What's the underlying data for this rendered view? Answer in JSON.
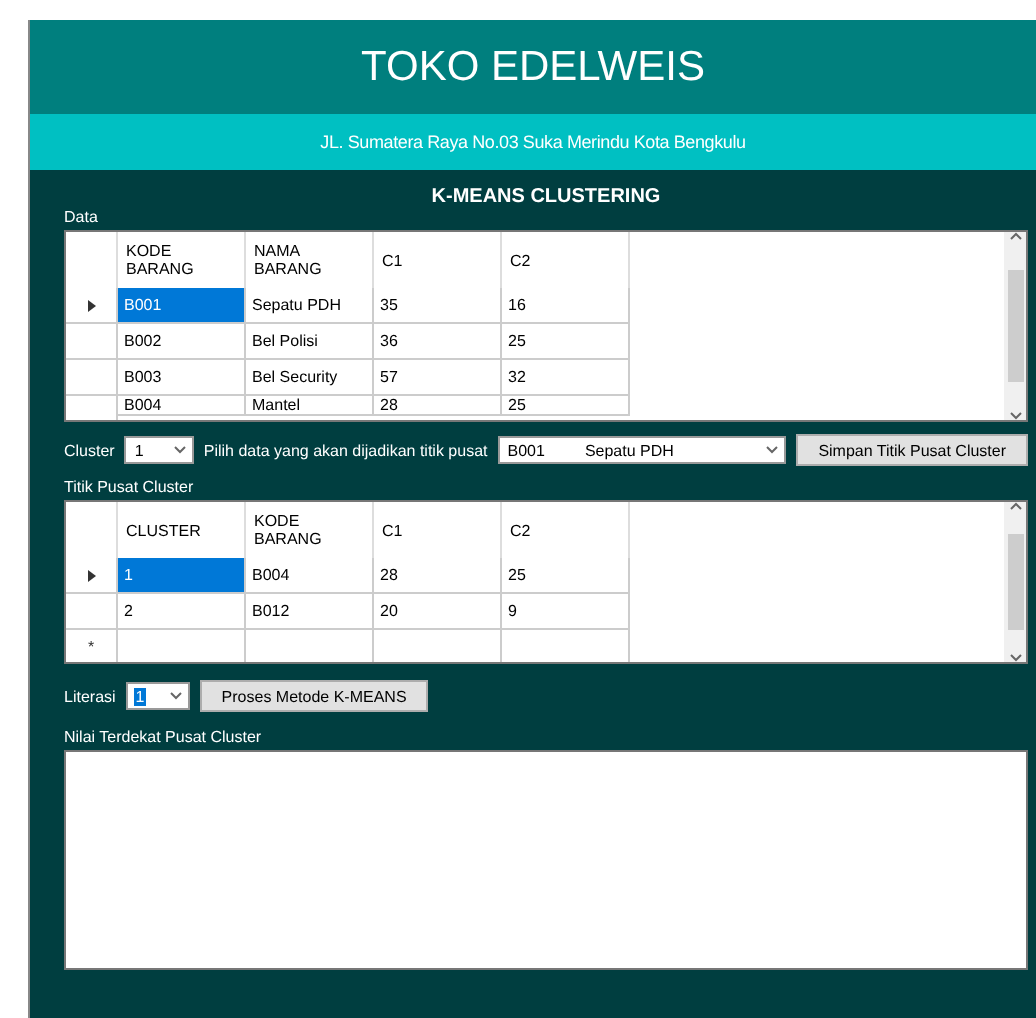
{
  "header": {
    "title": "TOKO EDELWEIS",
    "address": "JL. Sumatera Raya No.03 Suka Merindu Kota Bengkulu"
  },
  "heading": "K-MEANS CLUSTERING",
  "data_section": {
    "label": "Data",
    "columns": [
      "KODE\nBARANG",
      "NAMA\nBARANG",
      "C1",
      "C2"
    ],
    "rows": [
      {
        "selected": true,
        "cells": [
          "B001",
          "Sepatu PDH",
          "35",
          "16"
        ]
      },
      {
        "selected": false,
        "cells": [
          "B002",
          "Bel Polisi",
          "36",
          "25"
        ]
      },
      {
        "selected": false,
        "cells": [
          "B003",
          "Bel Security",
          "57",
          "32"
        ]
      },
      {
        "selected": false,
        "cut": true,
        "cells": [
          "B004",
          "Mantel",
          "28",
          "25"
        ]
      }
    ]
  },
  "cluster_row": {
    "label": "Cluster",
    "cluster_value": "1",
    "pick_label": "Pilih data yang akan dijadikan titik pusat",
    "pick_code": "B001",
    "pick_name": "Sepatu PDH",
    "button": "Simpan Titik Pusat Cluster"
  },
  "centers_section": {
    "label": "Titik Pusat Cluster",
    "columns": [
      "CLUSTER",
      "KODE\nBARANG",
      "C1",
      "C2"
    ],
    "rows": [
      {
        "selected": true,
        "cells": [
          "1",
          "B004",
          "28",
          "25"
        ]
      },
      {
        "selected": false,
        "cells": [
          "2",
          "B012",
          "20",
          "9"
        ]
      }
    ],
    "new_row_marker": "*"
  },
  "iteration_row": {
    "label": "Literasi",
    "value": "1",
    "highlighted": true,
    "button": "Proses Metode K-MEANS"
  },
  "result_section": {
    "label": "Nilai Terdekat Pusat Cluster"
  }
}
